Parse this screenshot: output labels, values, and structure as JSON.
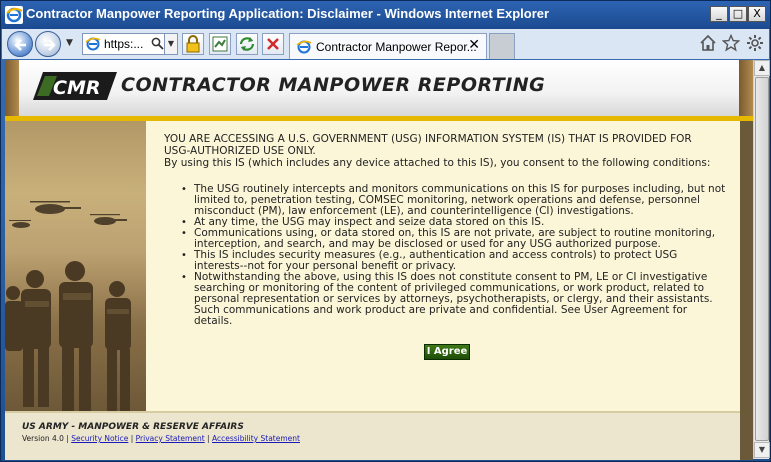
{
  "window": {
    "title": "Contractor Manpower Reporting Application: Disclaimer - Windows Internet Explorer",
    "controls": [
      "_",
      "□",
      "X"
    ]
  },
  "toolbar": {
    "address_text": "https:...",
    "tab_label": "Contractor Manpower Repor...",
    "tab_close": "✕"
  },
  "banner": {
    "logo_text": "CMR",
    "app_name": "CONTRACTOR MANPOWER REPORTING"
  },
  "notice": {
    "heading_line1": "YOU ARE ACCESSING A U.S. GOVERNMENT (USG) INFORMATION SYSTEM (IS) THAT IS PROVIDED FOR",
    "heading_line2": "USG-AUTHORIZED USE ONLY.",
    "consent": "By using this IS (which includes any device attached to this IS), you consent to the following conditions:",
    "items": [
      "The USG routinely intercepts and monitors communications on this IS for purposes including, but not limited to, penetration testing, COMSEC monitoring, network operations and defense, personnel misconduct (PM), law enforcement (LE), and counterintelligence (CI) investigations.",
      "At any time, the USG may inspect and seize data stored on this IS.",
      "Communications using, or data stored on, this IS are not private, are subject to routine monitoring, interception, and search, and may be disclosed or used for any USG authorized purpose.",
      "This IS includes security measures (e.g., authentication and access controls) to protect USG interests--not for your personal benefit or privacy.",
      "Notwithstanding the above, using this IS does not constitute consent to PM, LE or CI investigative searching or monitoring of the content of privileged communications, or work product, related to personal representation or services by attorneys, psychotherapists, or clergy, and their assistants. Such communications and work product are private and confidential. See User Agreement for details."
    ],
    "agree_label": "I Agree"
  },
  "footer": {
    "title": "US ARMY - MANPOWER & RESERVE AFFAIRS",
    "version": "Version 4.0",
    "links": [
      "Security Notice",
      "Privacy Statement",
      "Accessibility Statement"
    ]
  }
}
